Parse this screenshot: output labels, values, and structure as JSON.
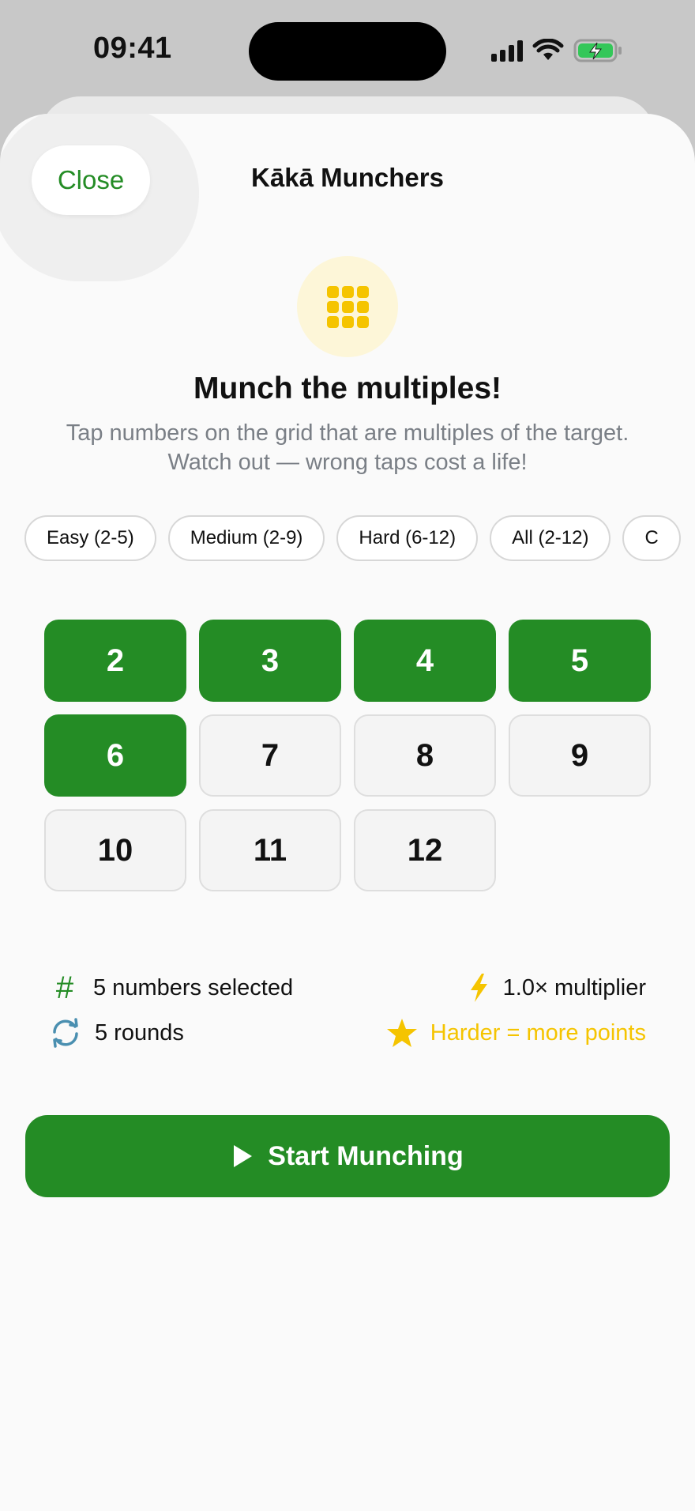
{
  "status_bar": {
    "time": "09:41"
  },
  "header": {
    "close_label": "Close",
    "title": "Kākā Munchers"
  },
  "hero": {
    "icon": "grid-icon",
    "headline": "Munch the multiples!",
    "subtitle_line1": "Tap numbers on the grid that are multiples of the target.",
    "subtitle_line2": "Watch out — wrong taps cost a life!"
  },
  "difficulty_chips": [
    {
      "label": "Easy (2-5)"
    },
    {
      "label": "Medium (2-9)"
    },
    {
      "label": "Hard (6-12)"
    },
    {
      "label": "All (2-12)"
    },
    {
      "label": "C"
    }
  ],
  "number_grid": [
    {
      "value": "2",
      "selected": true
    },
    {
      "value": "3",
      "selected": true
    },
    {
      "value": "4",
      "selected": true
    },
    {
      "value": "5",
      "selected": true
    },
    {
      "value": "6",
      "selected": true
    },
    {
      "value": "7",
      "selected": false
    },
    {
      "value": "8",
      "selected": false
    },
    {
      "value": "9",
      "selected": false
    },
    {
      "value": "10",
      "selected": false
    },
    {
      "value": "11",
      "selected": false
    },
    {
      "value": "12",
      "selected": false
    }
  ],
  "summary": {
    "numbers_selected": "5 numbers selected",
    "multiplier": "1.0× multiplier",
    "rounds": "5 rounds",
    "harder_note": "Harder = more points"
  },
  "start_button": {
    "label": "Start Munching"
  },
  "colors": {
    "accent_green": "#248c25",
    "highlight_yellow": "#f5c400",
    "round_icon_blue": "#4a8fb0",
    "battery_green": "#34c759"
  }
}
